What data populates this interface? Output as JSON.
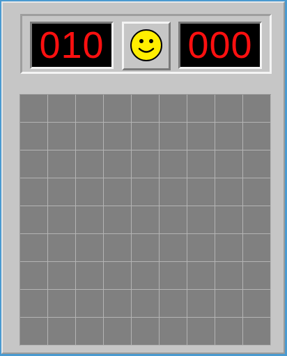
{
  "game": {
    "mines_remaining": "010",
    "timer": "000",
    "status_face": "smiley-face-icon",
    "rows": 9,
    "cols": 9
  },
  "colors": {
    "counter_digits": "#ff1010",
    "counter_bg": "#000000",
    "face_yellow": "#ffee00",
    "covered_cell": "#808080",
    "panel": "#c6c6c6"
  }
}
